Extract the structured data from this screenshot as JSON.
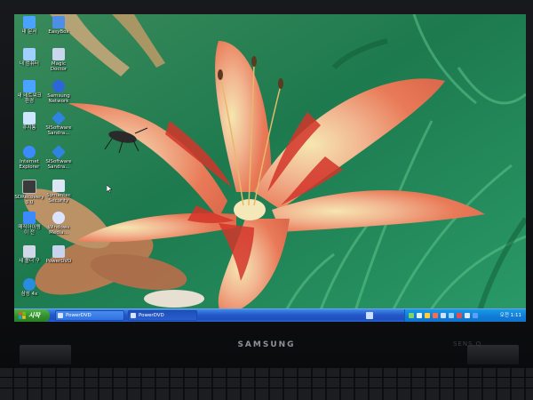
{
  "hardware": {
    "brand": "SAMSUNG",
    "brand_right": "SENS Q"
  },
  "desktop_icons": [
    {
      "label": "내 문서",
      "icon": "my-documents-icon",
      "color": "#4aa3ff"
    },
    {
      "label": "내 컴퓨터",
      "icon": "my-computer-icon",
      "color": "#9fd0ff"
    },
    {
      "label": "내 네트워크\n환경",
      "icon": "network-icon",
      "color": "#4aa3ff"
    },
    {
      "label": "휴지통",
      "icon": "recycle-bin-icon",
      "color": "#cfe6ff"
    },
    {
      "label": "Internet\nExplorer",
      "icon": "internet-explorer-icon",
      "color": "#3b8bff"
    },
    {
      "label": "SDRecovery\n3.0",
      "icon": "sd-recovery-icon",
      "color": "#3a3a3a"
    },
    {
      "label": "매직아이템\n이 전",
      "icon": "magic-item-icon",
      "color": "#3b8bff"
    },
    {
      "label": "새 폴더 구",
      "icon": "folder-icon",
      "color": "#d1d8e8"
    },
    {
      "label": "삼성 4x",
      "icon": "samsung-app-icon",
      "color": "#2a8ce0"
    },
    {
      "label": "EasyBox",
      "icon": "easybox-icon",
      "color": "#4d8fe6"
    },
    {
      "label": "Magic\nDoctor",
      "icon": "magic-doctor-icon",
      "color": "#c9d6ee"
    },
    {
      "label": "Samsung\nNetwork",
      "icon": "samsung-network-icon",
      "color": "#2e66d8"
    },
    {
      "label": "SISoftware\nSandra...",
      "icon": "sandra-icon",
      "color": "#2e84e0"
    },
    {
      "label": "SISoftware\nSandra...",
      "icon": "sandra-icon-2",
      "color": "#2e84e0"
    },
    {
      "label": "Symantec\nSecurity",
      "icon": "symantec-icon",
      "color": "#dde6f5"
    },
    {
      "label": "Windows\nMedia...",
      "icon": "windows-media-icon",
      "color": "#dbe4ff"
    },
    {
      "label": "PowerDVD",
      "icon": "powerdvd-icon",
      "color": "#c8d4ec"
    }
  ],
  "taskbar": {
    "start_label": "시작",
    "tasks": [
      {
        "label": "PowerDVD",
        "active": false
      },
      {
        "label": "PowerDVD",
        "active": true
      }
    ],
    "clock": "오전 1:11"
  }
}
